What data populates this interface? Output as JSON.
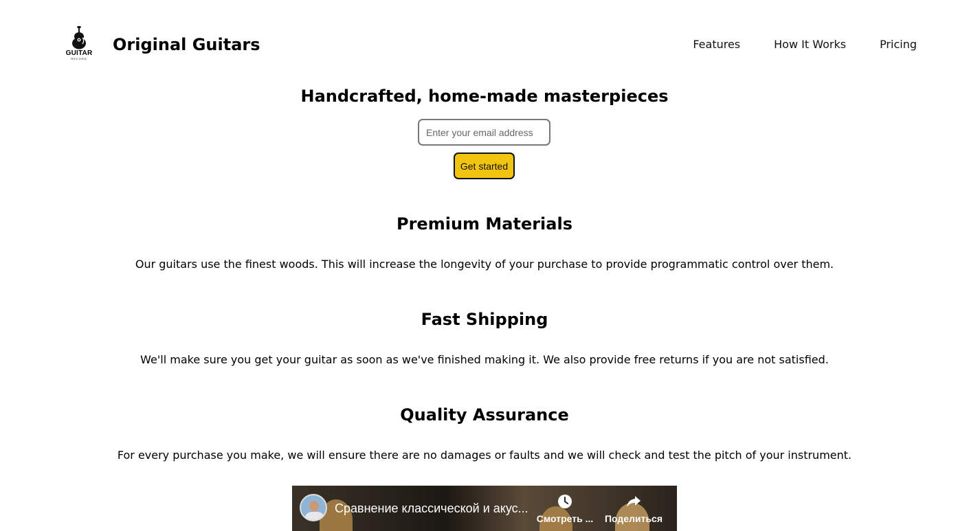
{
  "header": {
    "logo_text": "GUITAR",
    "logo_sub": "RECORD",
    "brand": "Original Guitars",
    "nav": [
      "Features",
      "How It Works",
      "Pricing"
    ]
  },
  "hero": {
    "title": "Handcrafted, home-made masterpieces",
    "email_placeholder": "Enter your email address",
    "cta_label": "Get started",
    "cta_color": "#f1c40f"
  },
  "features": [
    {
      "title": "Premium Materials",
      "text": "Our guitars use the finest woods. This will increase the longevity of your purchase to provide programmatic control over them."
    },
    {
      "title": "Fast Shipping",
      "text": "We'll make sure you get your guitar as soon as we've finished making it. We also provide free returns if you are not satisfied."
    },
    {
      "title": "Quality Assurance",
      "text": "For every purchase you make, we will ensure there are no damages or faults and we will check and test the pitch of your instrument."
    }
  ],
  "video": {
    "title": "Сравнение классической и акус...",
    "watch_later": "Смотреть ...",
    "share": "Поделиться"
  }
}
